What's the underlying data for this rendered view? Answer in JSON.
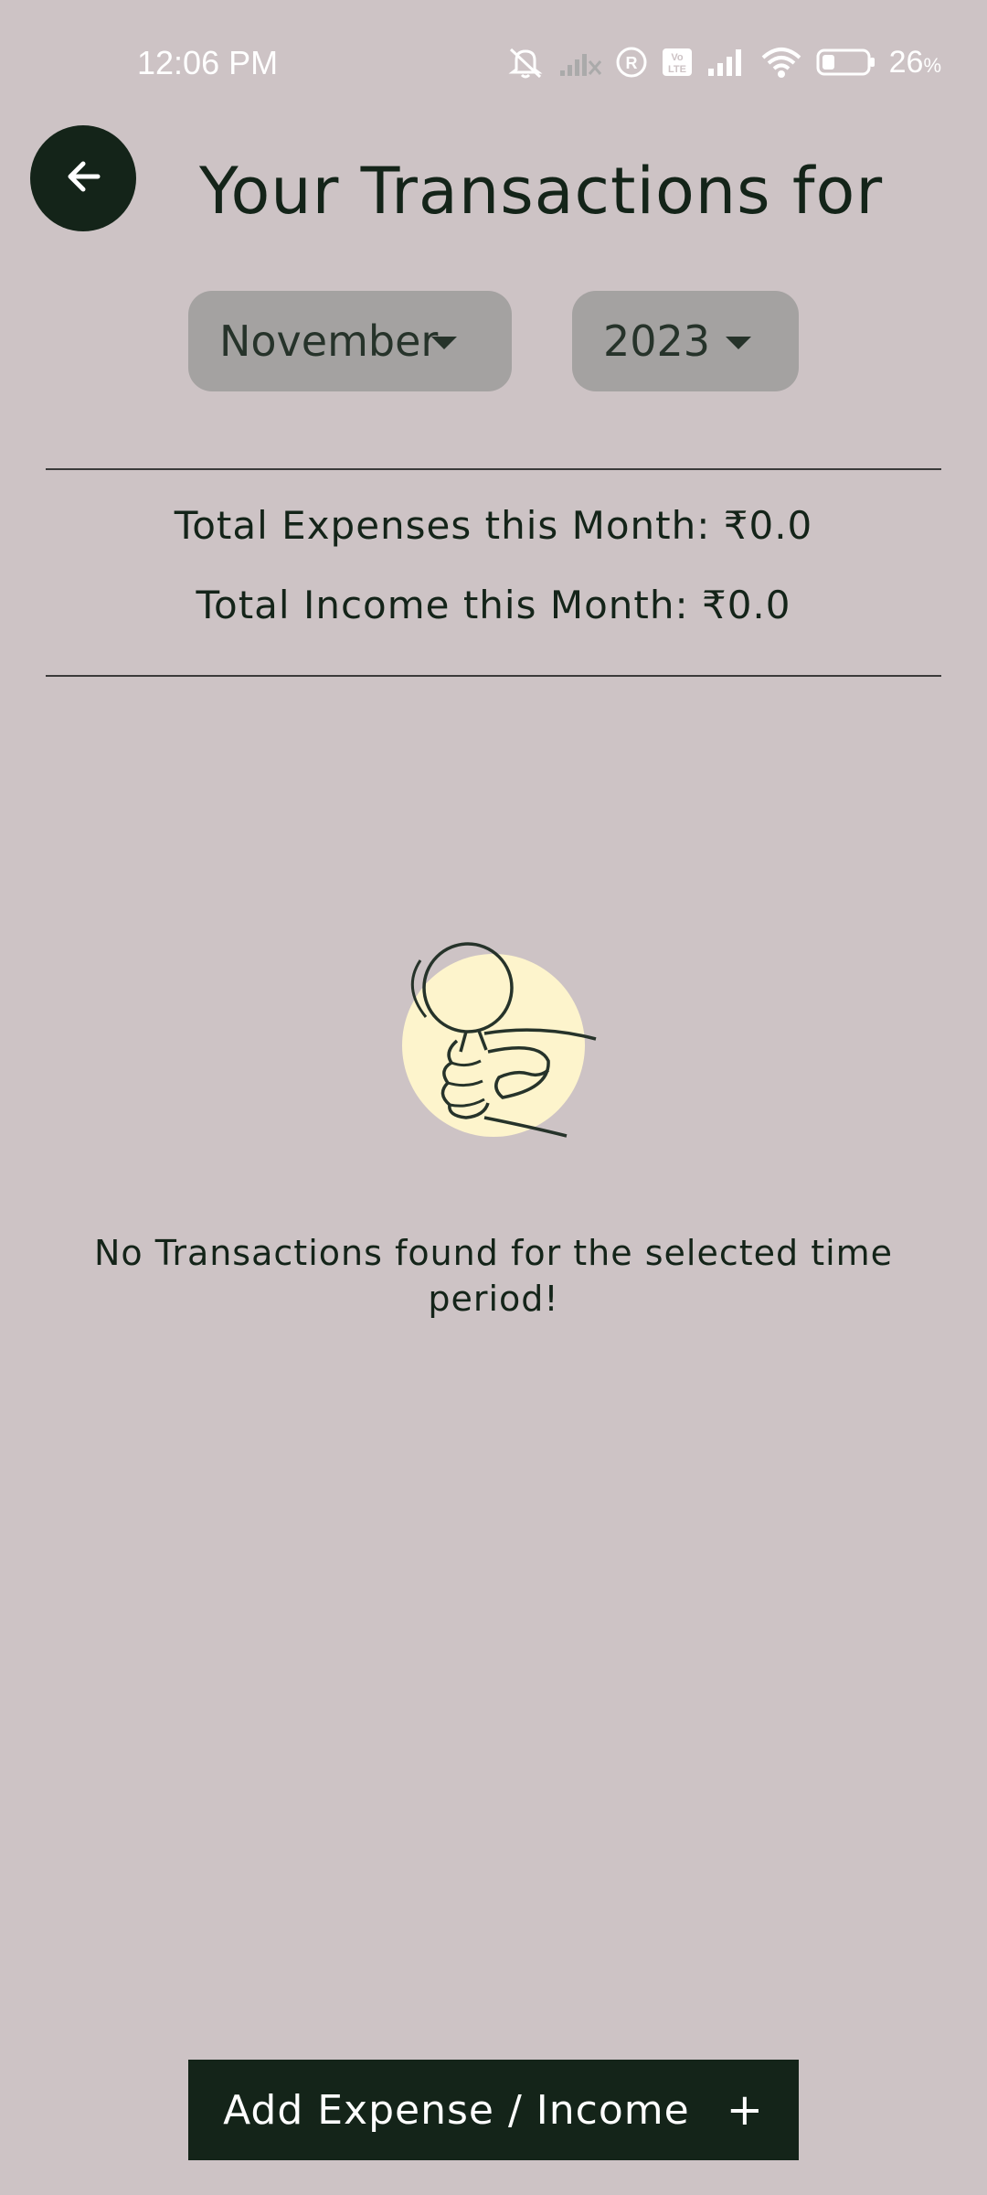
{
  "status_bar": {
    "time": "12:06 PM",
    "battery_percent": "26",
    "battery_unit": "%",
    "icons": [
      "mute-icon",
      "no-signal-icon",
      "registered-icon",
      "volte-icon",
      "signal-icon",
      "wifi-icon",
      "battery-icon"
    ]
  },
  "header": {
    "title": "Your Transactions for",
    "back_icon": "arrow-left-icon"
  },
  "filters": {
    "month": "November",
    "year": "2023"
  },
  "summary": {
    "expenses": "Total Expenses this Month: ₹0.0",
    "income": "Total Income this Month: ₹0.0"
  },
  "empty_state": {
    "illustration": "hand-holding-magnifier-icon",
    "message": "No Transactions found for the selected time period!"
  },
  "footer": {
    "add_label": "Add Expense / Income",
    "add_icon": "+"
  },
  "colors": {
    "background": "#cdc3c5",
    "primary": "#142419",
    "dropdown_bg": "#a4a2a1",
    "illustration_circle": "#fdf4cc"
  }
}
